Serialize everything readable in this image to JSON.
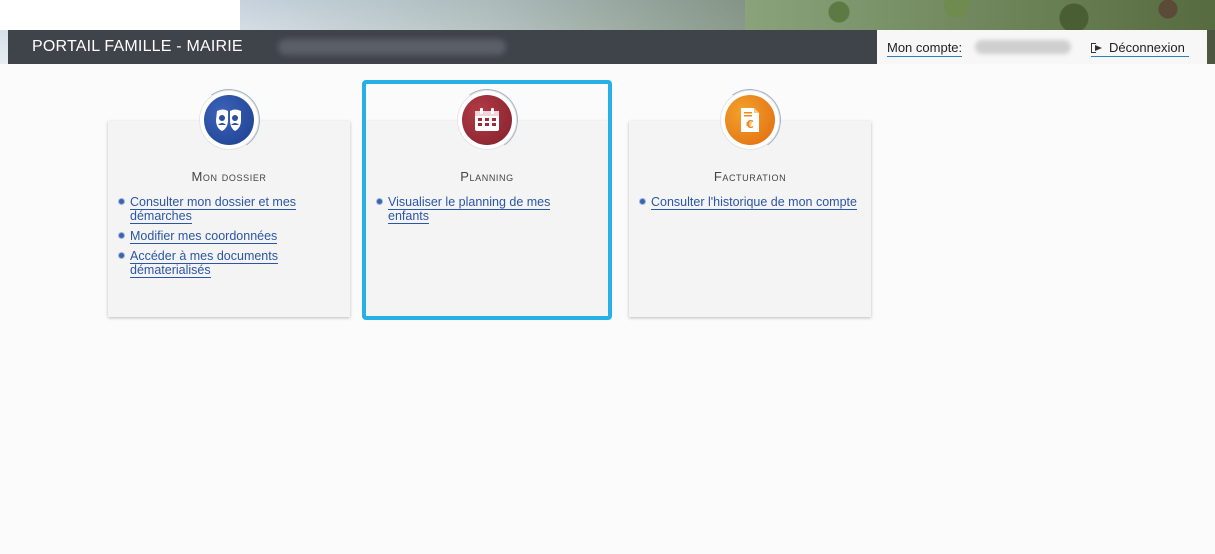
{
  "header": {
    "site_title": "PORTAIL FAMILLE - MAIRIE",
    "account_label": "Mon compte:",
    "logout_label": "Déconnexion"
  },
  "cards": [
    {
      "title": "Mon dossier",
      "icon": "shield-people-icon",
      "color": "#2a4fa3",
      "links": [
        "Consulter mon dossier et mes démarches",
        "Modifier mes coordonnées",
        "Accéder à mes documents dématerialisés"
      ]
    },
    {
      "title": "Planning",
      "icon": "calendar-icon",
      "color": "#9e2a35",
      "links": [
        "Visualiser le planning de mes enfants"
      ]
    },
    {
      "title": "Facturation",
      "icon": "invoice-euro-icon",
      "color": "#ee8a1c",
      "links": [
        "Consulter l'historique de mon compte"
      ]
    }
  ],
  "focus_color": "#26b0e6"
}
